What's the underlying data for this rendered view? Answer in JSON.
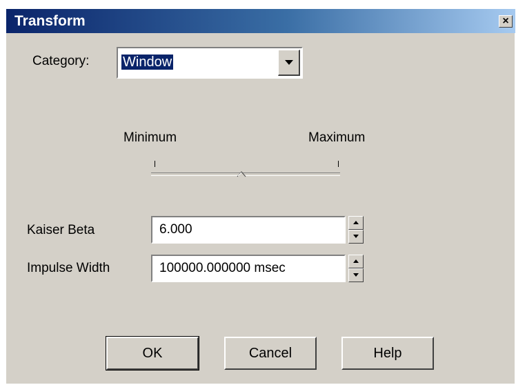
{
  "window": {
    "title": "Transform",
    "close_glyph": "×"
  },
  "category": {
    "label": "Category:",
    "value": "Window"
  },
  "slider": {
    "min_label": "Minimum",
    "max_label": "Maximum",
    "position": 0.46
  },
  "kaiser_beta": {
    "label": "Kaiser Beta",
    "value": "6.000"
  },
  "impulse_width": {
    "label": "Impulse Width",
    "value": "100000.000000 msec"
  },
  "buttons": {
    "ok": "OK",
    "cancel": "Cancel",
    "help": "Help"
  },
  "colors": {
    "titlebar_start": "#0a246a",
    "titlebar_end": "#a6caf0",
    "face": "#d4d0c8"
  },
  "icons": {
    "close": "close-icon",
    "dropdown": "chevron-down-icon",
    "spin_up": "arrow-up-icon",
    "spin_down": "arrow-down-icon"
  }
}
